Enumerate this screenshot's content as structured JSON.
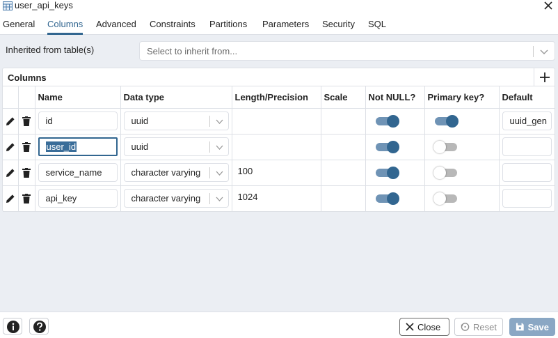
{
  "window": {
    "title": "user_api_keys",
    "title_icon": "table-icon",
    "close_icon": "close-icon"
  },
  "tabs": [
    {
      "label": "General",
      "active": false
    },
    {
      "label": "Columns",
      "active": true
    },
    {
      "label": "Advanced",
      "active": false
    },
    {
      "label": "Constraints",
      "active": false
    },
    {
      "label": "Partitions",
      "active": false
    },
    {
      "label": "Parameters",
      "active": false
    },
    {
      "label": "Security",
      "active": false
    },
    {
      "label": "SQL",
      "active": false
    }
  ],
  "inherit": {
    "label": "Inherited from table(s)",
    "placeholder": "Select to inherit from..."
  },
  "columns_panel": {
    "title": "Columns",
    "add_icon": "plus-icon",
    "headers": {
      "name": "Name",
      "data_type": "Data type",
      "length": "Length/Precision",
      "scale": "Scale",
      "not_null": "Not NULL?",
      "primary_key": "Primary key?",
      "default": "Default"
    },
    "rows": [
      {
        "name": "id",
        "data_type": "uuid",
        "length": "",
        "scale": "",
        "not_null": true,
        "primary_key": true,
        "default": "uuid_gen"
      },
      {
        "name": "user_id",
        "data_type": "uuid",
        "length": "",
        "scale": "",
        "not_null": true,
        "primary_key": false,
        "default": ""
      },
      {
        "name": "service_name",
        "data_type": "character varying",
        "length": "100",
        "scale": "",
        "not_null": true,
        "primary_key": false,
        "default": ""
      },
      {
        "name": "api_key",
        "data_type": "character varying",
        "length": "1024",
        "scale": "",
        "not_null": true,
        "primary_key": false,
        "default": ""
      }
    ]
  },
  "footer": {
    "info_icon": "info-icon",
    "help_icon": "help-icon",
    "close_label": "Close",
    "reset_label": "Reset",
    "save_label": "Save"
  },
  "colors": {
    "accent": "#326690",
    "toggle_track_on": "#6f93b5",
    "toggle_track_off": "#b8b8b8",
    "save_disabled": "#8aa7c4",
    "background": "#ebeef3"
  }
}
